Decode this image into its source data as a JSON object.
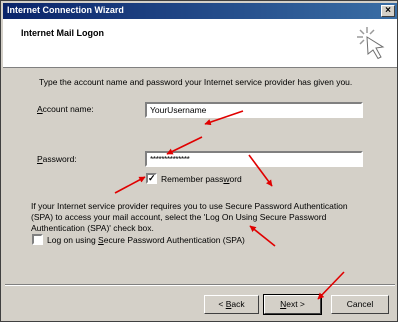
{
  "window": {
    "title": "Internet Connection Wizard",
    "close_glyph": "×"
  },
  "header": {
    "title": "Internet Mail Logon",
    "icon": "wizard-wand-icon"
  },
  "intro": "Type the account name and password your Internet service provider has given you.",
  "account": {
    "label_pre": "",
    "label_ul": "A",
    "label_post": "ccount name:",
    "value": "YourUsername"
  },
  "password": {
    "label_pre": "",
    "label_ul": "P",
    "label_post": "assword:",
    "value": "**************"
  },
  "remember": {
    "label_pre": "Remember pass",
    "label_ul": "w",
    "label_post": "ord",
    "checked": "✓"
  },
  "spa_text": "If your Internet service provider requires you to use Secure Password Authentication (SPA) to access your mail account, select the 'Log On Using Secure Password Authentication (SPA)' check box.",
  "spa_check": {
    "label_pre": "Log on using ",
    "label_ul": "S",
    "label_post": "ecure Password Authentication (SPA)",
    "checked": ""
  },
  "buttons": {
    "back": {
      "pre": "< ",
      "ul": "B",
      "post": "ack"
    },
    "next": {
      "pre": "",
      "ul": "N",
      "post": "ext >"
    },
    "cancel": "Cancel"
  },
  "colors": {
    "title_start": "#0a246a",
    "title_end": "#3a6ea5",
    "dialog_bg": "#d4d0c8",
    "annotation_arrow": "#e00000"
  }
}
